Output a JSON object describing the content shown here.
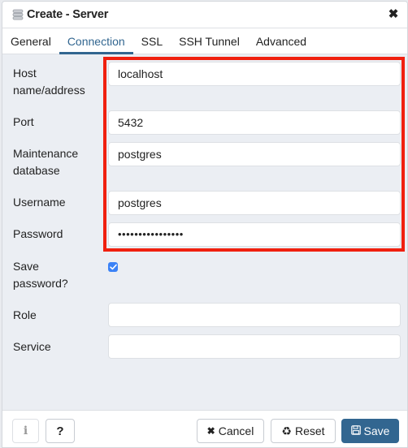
{
  "dialog": {
    "title": "Create - Server",
    "title_icon": "server-icon",
    "close_icon": "close-icon"
  },
  "tabs": [
    {
      "label": "General",
      "active": false
    },
    {
      "label": "Connection",
      "active": true
    },
    {
      "label": "SSL",
      "active": false
    },
    {
      "label": "SSH Tunnel",
      "active": false
    },
    {
      "label": "Advanced",
      "active": false
    }
  ],
  "form": {
    "host": {
      "label_line1": "Host",
      "label_line2": "name/address",
      "value": "localhost"
    },
    "port": {
      "label": "Port",
      "value": "5432"
    },
    "maintenance_db": {
      "label_line1": "Maintenance",
      "label_line2": "database",
      "value": "postgres"
    },
    "username": {
      "label": "Username",
      "value": "postgres"
    },
    "password": {
      "label": "Password",
      "value": "••••••••••••••••"
    },
    "save_password": {
      "label_line1": "Save",
      "label_line2": "password?",
      "checked": true
    },
    "role": {
      "label": "Role",
      "value": ""
    },
    "service": {
      "label": "Service",
      "value": ""
    }
  },
  "highlight": {
    "color": "#f0200f"
  },
  "footer": {
    "info_label": "i",
    "help_label": "?",
    "cancel_label": "Cancel",
    "reset_label": "Reset",
    "save_label": "Save",
    "accent_color": "#326690"
  }
}
